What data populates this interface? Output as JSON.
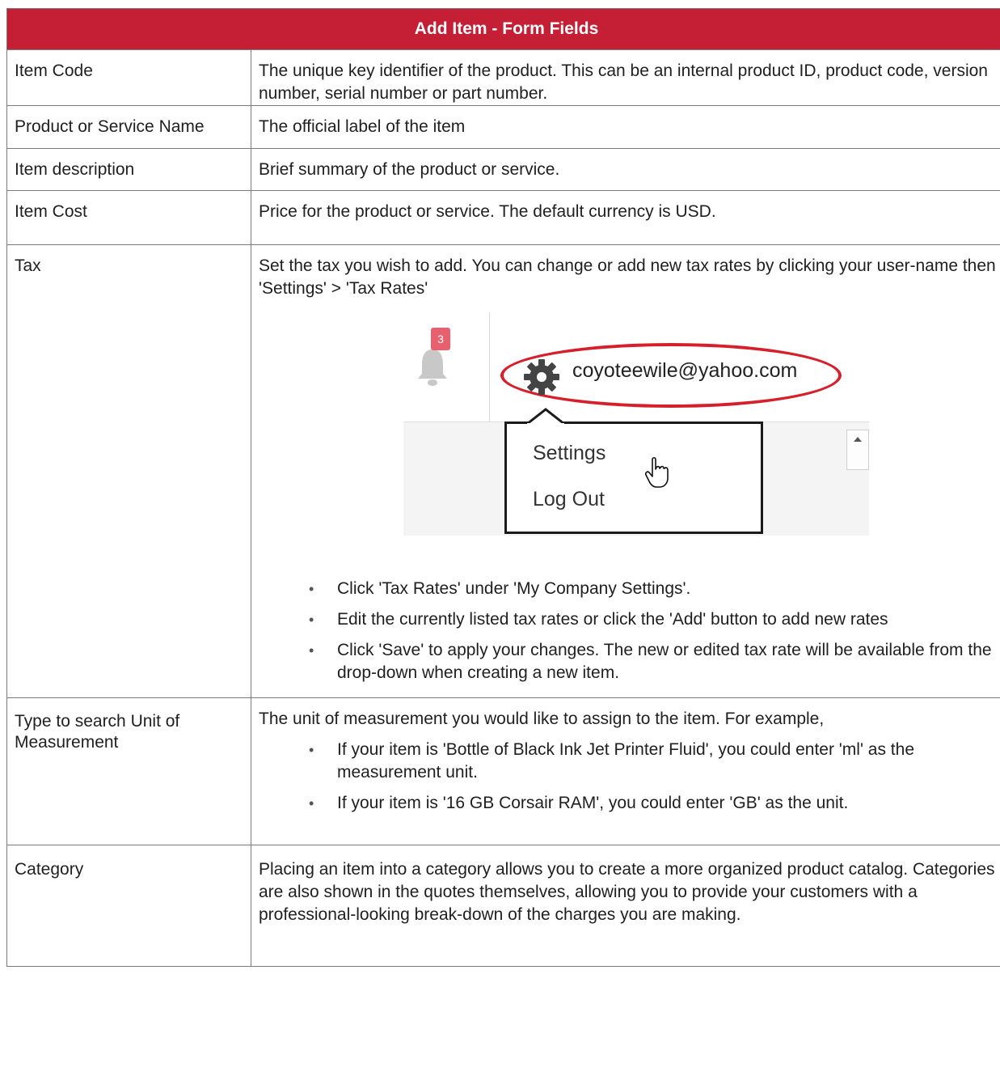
{
  "table": {
    "title": "Add Item - Form Fields",
    "rows": [
      {
        "field": "Item Code",
        "desc": "The unique key identifier of the product. This can be an internal product ID, product code, version number, serial number or part number."
      },
      {
        "field": "Product or Service Name",
        "desc": "The official label of the item"
      },
      {
        "field": "Item description",
        "desc": "Brief summary of the product or service."
      },
      {
        "field": "Item Cost",
        "desc": "Price for the product or service. The default currency is USD."
      },
      {
        "field": "Tax",
        "desc": "Set the tax you wish to add. You can change or add new tax rates by clicking your user-name then 'Settings' > 'Tax Rates'",
        "bullets": [
          "Click 'Tax Rates' under 'My Company Settings'.",
          "Edit the currently listed tax rates or click the 'Add' button to add new rates",
          "Click 'Save' to apply your changes. The new or edited tax rate will be available from the drop-down when creating a new item."
        ]
      },
      {
        "field": "Type to search Unit of Measurement",
        "desc": "The unit of measurement you would like to assign to the item. For example,",
        "bullets": [
          "If your item is 'Bottle of Black Ink Jet Printer Fluid', you could enter 'ml' as the measurement unit.",
          "If your item is '16 GB Corsair RAM', you could enter 'GB' as the unit."
        ]
      },
      {
        "field": "Category",
        "desc": "Placing an item into a category allows you to create a more organized product catalog. Categories are also shown in the quotes themselves, allowing you to provide your customers with a professional-looking break-down of the charges you are making."
      }
    ]
  },
  "screenshot": {
    "badge_count": "3",
    "email": "coyoteewile@yahoo.com",
    "menu_items": [
      "Settings",
      "Log Out"
    ],
    "highlight_color": "#d61f2b"
  },
  "colors": {
    "header_bg": "#c41f34",
    "header_text": "#ffffff",
    "border": "#7a7a7a"
  }
}
